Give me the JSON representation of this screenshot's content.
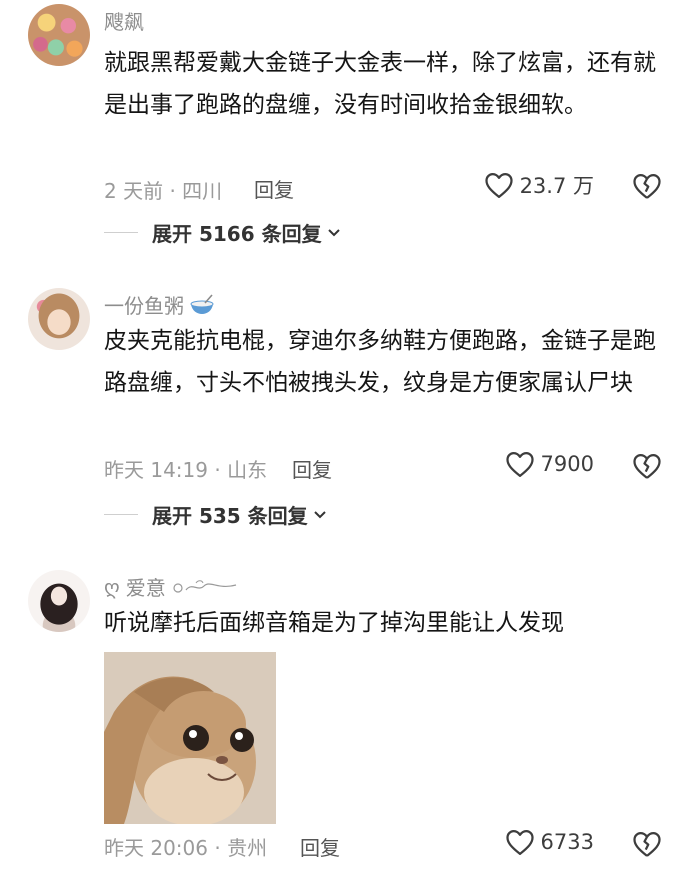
{
  "comments": [
    {
      "username": "飕飙",
      "text": "就跟黑帮爱戴大金链子大金表一样，除了炫富，还有就是出事了跑路的盘缠，没有时间收拾金银细软。",
      "meta": "2 天前 · 四川",
      "reply_label": "回复",
      "likes": "23.7 万",
      "expand_label": "展开 5166 条回复"
    },
    {
      "username": "一份鱼粥",
      "text": "皮夹克能抗电棍，穿迪尔多纳鞋方便跑路，金链子是跑路盘缠，寸头不怕被拽头发，纹身是方便家属认尸块",
      "meta": "昨天 14:19 · 山东",
      "reply_label": "回复",
      "likes": "7900",
      "expand_label": "展开 535 条回复"
    },
    {
      "username": "爱意",
      "username_prefix": "ღ",
      "text": "听说摩托后面绑音箱是为了掉沟里能让人发现",
      "meta": "昨天 20:06 · 贵州",
      "reply_label": "回复",
      "likes": "6733"
    }
  ],
  "icons": {
    "like": "heart-outline-icon",
    "dislike": "broken-heart-icon",
    "expand": "chevron-down-icon",
    "username_emoji": "rice-bowl-icon",
    "username_decoration": "swirl-decoration-icon"
  },
  "colors": {
    "text": "#151515",
    "meta": "#9a9a9a",
    "username": "#8d8d8d"
  }
}
